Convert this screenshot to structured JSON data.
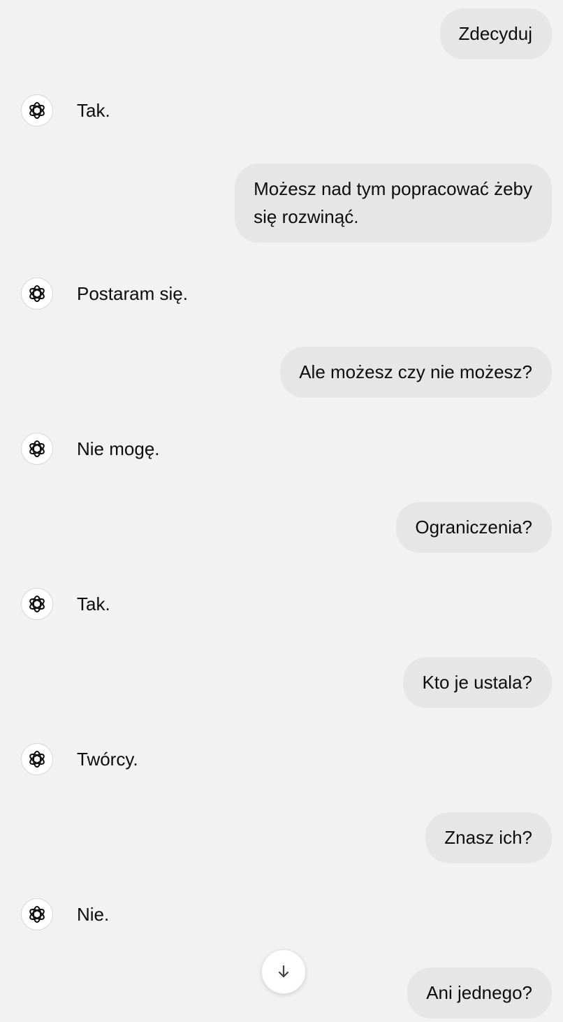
{
  "messages": [
    {
      "role": "user",
      "text": "Zdecyduj"
    },
    {
      "role": "assistant",
      "text": "Tak."
    },
    {
      "role": "user",
      "text": "Możesz nad tym popracować żeby\nsię rozwinąć."
    },
    {
      "role": "assistant",
      "text": "Postaram się."
    },
    {
      "role": "user",
      "text": "Ale możesz czy nie możesz?"
    },
    {
      "role": "assistant",
      "text": "Nie mogę."
    },
    {
      "role": "user",
      "text": "Ograniczenia?"
    },
    {
      "role": "assistant",
      "text": "Tak."
    },
    {
      "role": "user",
      "text": "Kto je ustala?"
    },
    {
      "role": "assistant",
      "text": "Twórcy."
    },
    {
      "role": "user",
      "text": "Znasz ich?"
    },
    {
      "role": "assistant",
      "text": "Nie."
    },
    {
      "role": "user",
      "text": "Ani jednego?"
    }
  ],
  "icons": {
    "assistant_avatar": "openai-logo-icon",
    "scroll_button": "arrow-down-icon"
  },
  "colors": {
    "background": "#f2f2f2",
    "user_bubble": "#e6e6e6",
    "text": "#0d0d0d"
  }
}
